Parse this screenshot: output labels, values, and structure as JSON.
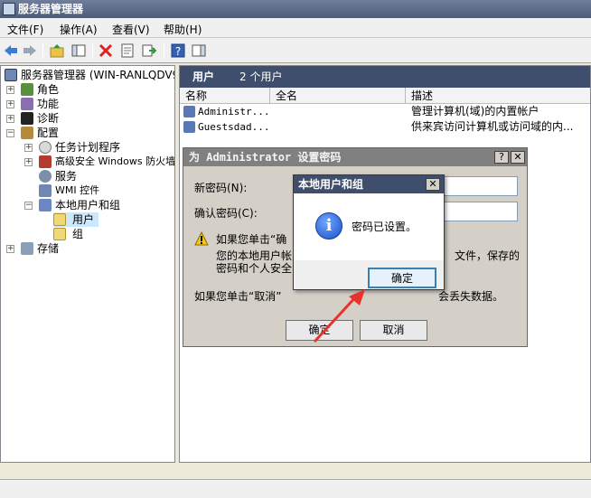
{
  "window": {
    "title": "服务器管理器"
  },
  "menu": [
    "文件(F)",
    "操作(A)",
    "查看(V)",
    "帮助(H)"
  ],
  "tree": {
    "root": "服务器管理器 (WIN-RANLQDV993",
    "items": [
      "角色",
      "功能",
      "诊断",
      "配置",
      "任务计划程序",
      "高级安全 Windows 防火墙",
      "服务",
      "WMI 控件",
      "本地用户和组",
      "用户",
      "组",
      "存储"
    ]
  },
  "rightpane": {
    "title": "用户",
    "count": "2 个用户",
    "columns": [
      "名称",
      "全名",
      "描述"
    ],
    "rows": [
      {
        "name": "Administr...",
        "desc": "管理计算机(域)的内置帐户"
      },
      {
        "name": "Guestsdad...",
        "desc": "供来宾访问计算机或访问域的内..."
      }
    ]
  },
  "pwdialog": {
    "title": "为 Administrator 设置密码",
    "new_label": "新密码(N):",
    "confirm_label": "确认密码(C):",
    "warning_line1": "如果您单击“确",
    "warning_line2": "您的本地用户帐",
    "warning_line2b": "文件，保存的",
    "warning_line3": "密码和个人安全",
    "cancel_note_a": "如果您单击“取消”",
    "cancel_note_b": "会丢失数据。",
    "ok": "确定",
    "cancel": "取消",
    "help_glyph": "?",
    "close_glyph": "✕"
  },
  "msgbox": {
    "title": "本地用户和组",
    "message": "密码已设置。",
    "ok": "确定",
    "icon_glyph": "i",
    "close_glyph": "✕"
  },
  "colors": {
    "accent": "#3f4e6c",
    "arrow": "#e8322d"
  }
}
